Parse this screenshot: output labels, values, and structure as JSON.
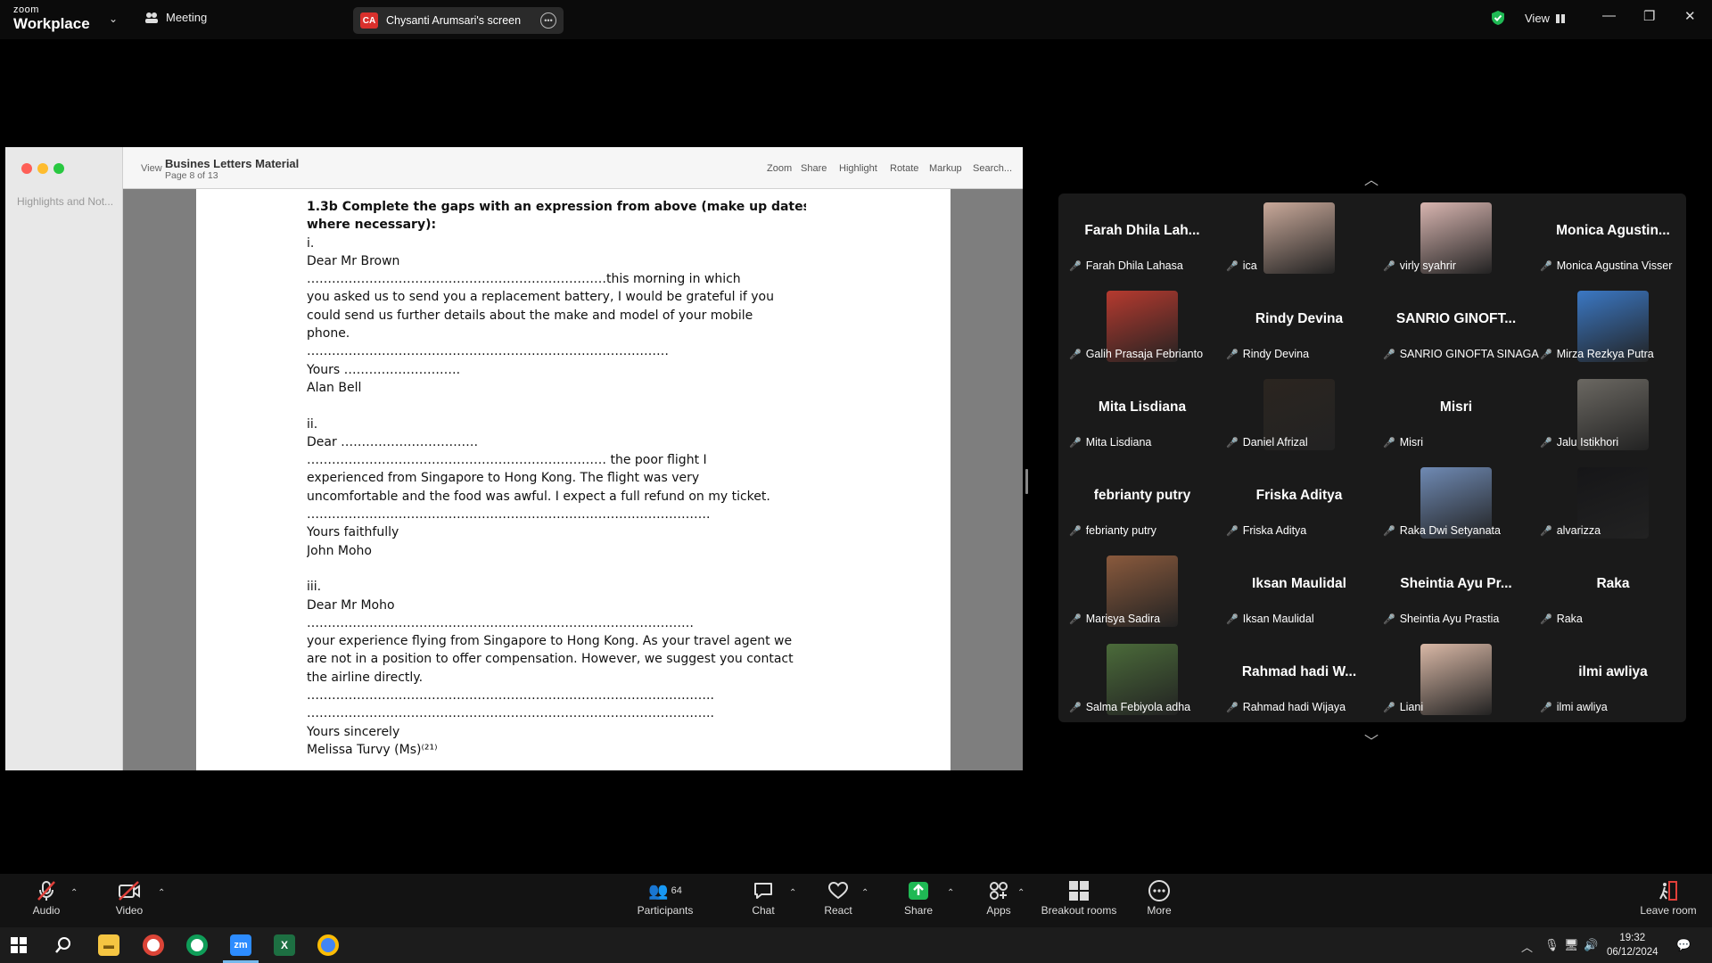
{
  "topbar": {
    "logo_line1": "zoom",
    "logo_line2": "Workplace",
    "meeting_label": "Meeting",
    "screen_badge": "CA",
    "screen_label": "Chysanti Arumsari's screen",
    "view_label": "View"
  },
  "viewer": {
    "side_label": "Highlights and Not...",
    "view_label": "View",
    "doc_title": "Busines Letters Material",
    "page_label": "Page 8 of 13",
    "tools": [
      "Zoom",
      "Share",
      "Highlight",
      "Rotate",
      "Markup",
      "Search..."
    ]
  },
  "document": {
    "lines": [
      "1.3b Complete the gaps with an expression from above (make up dates",
      "where necessary):",
      "i.",
      "Dear Mr Brown",
      "………………………………………………………………this morning in which",
      "you asked us to send you a replacement battery, I would be grateful if you",
      "could send us further details about the make and model of your mobile",
      "phone.",
      "……………………………………………………………………………",
      "Yours ……………………….",
      "Alan Bell",
      "",
      "ii.",
      "Dear ……………………………",
      "……………………………………………………………… the poor flight I",
      "experienced from Singapore to Hong Kong. The flight was very",
      "uncomfortable and the food was awful. I expect a full refund on my ticket.",
      "…………………………………………………………………………………….",
      "Yours faithfully",
      "John Moho",
      "",
      "iii.",
      "Dear Mr Moho",
      "…………………………………………………………………………………",
      "your experience flying from Singapore to Hong Kong. As your travel agent we",
      "are not in a position to offer compensation. However, we suggest you contact",
      "the airline directly.",
      "……………………………………………………………………………………..",
      "……………………………………………………………………………………..",
      "Yours sincerely",
      "Melissa Turvy (Ms)⁽²¹⁾"
    ]
  },
  "participants": [
    {
      "big": "Farah Dhila Lah...",
      "name": "Farah Dhila Lahasa"
    },
    {
      "big": "",
      "name": "ica",
      "photo": "#c9a99a"
    },
    {
      "big": "",
      "name": "virly syahrir",
      "photo": "#d8b5b0"
    },
    {
      "big": "Monica  Agustin...",
      "name": "Monica Agustina Visser"
    },
    {
      "big": "",
      "name": "Galih Prasaja Febrianto",
      "photo": "#b63a2f"
    },
    {
      "big": "Rindy Devina",
      "name": "Rindy Devina"
    },
    {
      "big": "SANRIO GINOFT...",
      "name": "SANRIO GINOFTA SINAGA"
    },
    {
      "big": "",
      "name": "Mirza Rezkya Putra",
      "photo": "#3b78c4"
    },
    {
      "big": "Mita Lisdiana",
      "name": "Mita Lisdiana"
    },
    {
      "big": "",
      "name": "Daniel Afrizal",
      "photo": "#2b2520"
    },
    {
      "big": "Misri",
      "name": "Misri"
    },
    {
      "big": "",
      "name": "Jalu Istikhori",
      "photo": "#6b6862"
    },
    {
      "big": "febrianty putry",
      "name": "febrianty putry"
    },
    {
      "big": "Friska Aditya",
      "name": "Friska Aditya"
    },
    {
      "big": "",
      "name": "Raka Dwi Setyanata",
      "photo": "#6f8ab4"
    },
    {
      "big": "",
      "name": "alvarizza",
      "photo": "#161618"
    },
    {
      "big": "",
      "name": "Marisya Sadira",
      "photo": "#8a5a3d"
    },
    {
      "big": "Iksan Maulidal",
      "name": "Iksan Maulidal"
    },
    {
      "big": "Sheintia Ayu Pr...",
      "name": "Sheintia Ayu Prastia"
    },
    {
      "big": "Raka",
      "name": "Raka"
    },
    {
      "big": "",
      "name": "Salma Febiyola adha",
      "photo": "#4b6b3a"
    },
    {
      "big": "Rahmad hadi W...",
      "name": "Rahmad hadi Wijaya"
    },
    {
      "big": "",
      "name": "Liani",
      "photo": "#d9b8a6"
    },
    {
      "big": "ilmi awliya",
      "name": "ilmi awliya"
    }
  ],
  "toolbar": {
    "audio": "Audio",
    "video": "Video",
    "participants_count": "64",
    "participants": "Participants",
    "chat": "Chat",
    "react": "React",
    "share": "Share",
    "apps": "Apps",
    "breakout": "Breakout rooms",
    "more": "More",
    "leave": "Leave room"
  },
  "taskbar": {
    "zoom_icon": "zm",
    "excel_icon": "X",
    "time": "19:32",
    "date": "06/12/2024"
  },
  "colors": {
    "accent_green": "#1fb954",
    "muted_red": "#e0403a",
    "share_green": "#1fb954"
  }
}
